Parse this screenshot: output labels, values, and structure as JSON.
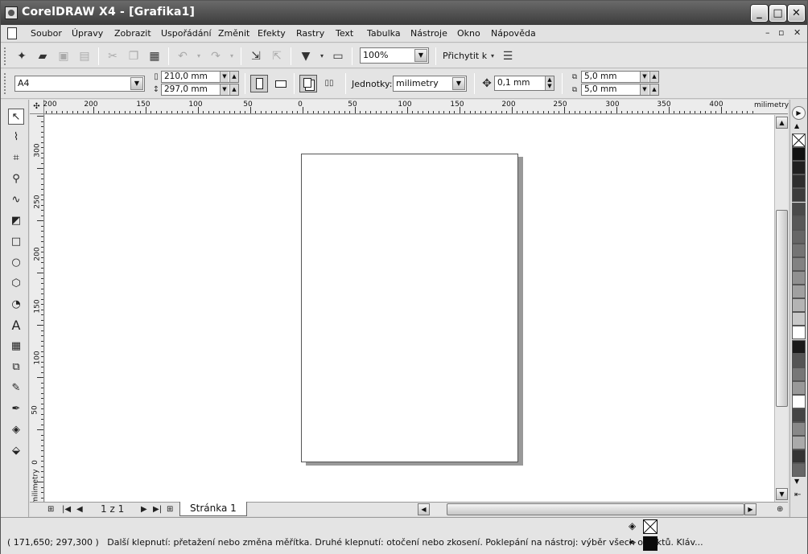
{
  "window": {
    "title": "CorelDRAW X4 - [Grafika1]",
    "min": "_",
    "max": "□",
    "close": "✕"
  },
  "menu": [
    "Soubor",
    "Úpravy",
    "Zobrazit",
    "Uspořádání",
    "Změnit",
    "Efekty",
    "Rastry",
    "Text",
    "Tabulka",
    "Nástroje",
    "Okno",
    "Nápověda"
  ],
  "mdi": {
    "min": "–",
    "restore": "▫",
    "close": "✕"
  },
  "toolbar1": {
    "zoom": "100%",
    "snap": "Přichytit k"
  },
  "toolbar2": {
    "paper": "A4",
    "width": "210,0 mm",
    "height": "297,0 mm",
    "units_label": "Jednotky:",
    "units": "milimetry",
    "nudge": "0,1 mm",
    "dup_x": "5,0 mm",
    "dup_y": "5,0 mm"
  },
  "ruler": {
    "unit": "milimetry",
    "h_labels": [
      "200",
      "150",
      "100",
      "50",
      "0",
      "50",
      "100",
      "150",
      "200",
      "250",
      "300",
      "350",
      "400"
    ],
    "v_labels": [
      "300",
      "250",
      "200",
      "150",
      "100",
      "50",
      "0"
    ]
  },
  "pagenav": {
    "count": "1 z 1",
    "tab": "Stránka 1"
  },
  "status": {
    "coords": "( 171,650; 297,300 )",
    "hint": "Další klepnutí: přetažení nebo změna měřítka. Druhé klepnutí: otočení  nebo zkosení. Poklepání na nástroj: výběr všech objektů. Kláv..."
  },
  "palette": [
    "none",
    "#111111",
    "#202020",
    "#2e2e2e",
    "#3c3c3c",
    "#4a4a4a",
    "#585858",
    "#666666",
    "#747474",
    "#828282",
    "#909090",
    "#a0a0a0",
    "#b4b4b4",
    "#c8c8c8",
    "#ffffff",
    "#1a1a1a",
    "#555555",
    "#777777",
    "#999999",
    "#ffffff",
    "#444444",
    "#888888",
    "#aaaaaa",
    "#333333",
    "#666666",
    "#999999",
    "#bbbbbb",
    "#555555",
    "#7a7a7a",
    "#a0a0a0",
    "#606060",
    "#8a8a8a",
    "#505050",
    "#6c6c6c",
    "#909090",
    "#aaaaaa",
    "#404040"
  ]
}
